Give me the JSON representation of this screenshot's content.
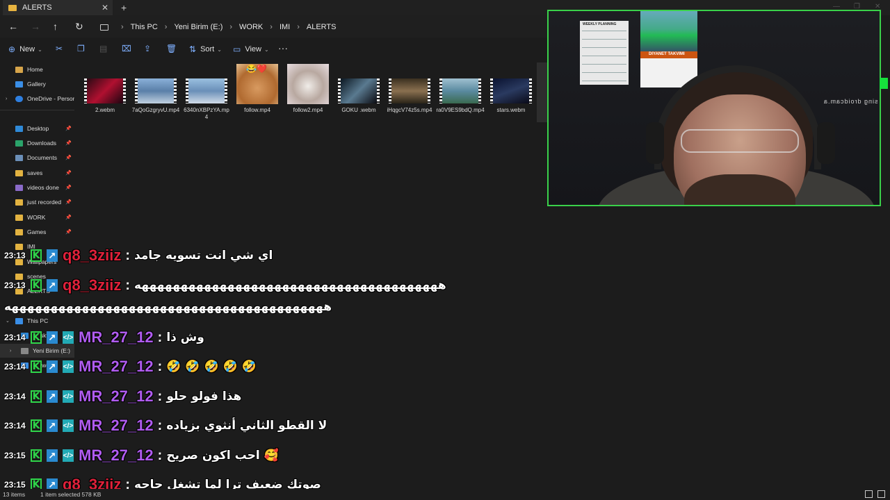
{
  "titlebar": {
    "tab_title": "ALERTS",
    "close_glyph": "✕",
    "new_tab_glyph": "+"
  },
  "address": {
    "crumbs": [
      "This PC",
      "Yeni Birim (E:)",
      "WORK",
      "IMI",
      "ALERTS"
    ],
    "separator": "›"
  },
  "toolbar": {
    "new_label": "New",
    "sort_label": "Sort",
    "view_label": "View",
    "more_glyph": "···"
  },
  "sidebar": {
    "items": [
      {
        "label": "Home"
      },
      {
        "label": "Gallery"
      },
      {
        "label": "OneDrive - Persona"
      },
      {
        "label": "Desktop"
      },
      {
        "label": "Downloads"
      },
      {
        "label": "Documents"
      },
      {
        "label": "saves"
      },
      {
        "label": "videos done"
      },
      {
        "label": "just recorded"
      },
      {
        "label": "WORK"
      },
      {
        "label": "Games"
      },
      {
        "label": "IMI"
      },
      {
        "label": "Wallpapers"
      },
      {
        "label": "scenes"
      },
      {
        "label": "ALERTS"
      },
      {
        "label": "This PC"
      },
      {
        "label": "Desktop"
      },
      {
        "label": "Yeni Birim (E:)"
      },
      {
        "label": "Network"
      }
    ]
  },
  "files": [
    {
      "name": "2.webm",
      "color": "#b01030"
    },
    {
      "name": "7aQoGzgryvU.mp4",
      "color": "#7aa0c8"
    },
    {
      "name": "6340nXBPzYA.mp4",
      "color": "#8aaed0"
    },
    {
      "name": "follow.mp4",
      "color": "#d89a60"
    },
    {
      "name": "follow2.mp4",
      "color": "#d8c8c0"
    },
    {
      "name": "GOKU .webm",
      "color": "#5a7a90"
    },
    {
      "name": "iHqgcV74z5s.mp4",
      "color": "#6a5a3a"
    },
    {
      "name": "ra0V9ES9bdQ.mp4",
      "color": "#5a8aa0"
    },
    {
      "name": "stars.webm",
      "color": "#2a3a60"
    }
  ],
  "webcam": {
    "planner_title": "WEEKLY PLANNING",
    "calendar_title": "DIYANET TAKVIMI",
    "mirrored_text": "sing droidcam.a"
  },
  "chat": [
    {
      "time": "23:13",
      "user": "q8_3ziiz",
      "color": "#e0213a",
      "text": "اي شي انت تسويه جامد"
    },
    {
      "time": "23:13",
      "user": "q8_3ziiz",
      "color": "#e0213a",
      "text": "هههههههههههههههههههههههههههههههههههههههه"
    },
    {
      "time": "23:14",
      "user": "MR_27_12",
      "color": "#b05cf0",
      "text": "وش ذا"
    },
    {
      "time": "23:14",
      "user": "MR_27_12",
      "color": "#b05cf0",
      "text": "🤣 🤣 🤣 🤣 🤣"
    },
    {
      "time": "23:14",
      "user": "MR_27_12",
      "color": "#b05cf0",
      "text": "هذا فولو حلو"
    },
    {
      "time": "23:14",
      "user": "MR_27_12",
      "color": "#b05cf0",
      "text": "لا القطو الثاني أنثوي بزياده"
    },
    {
      "time": "23:15",
      "user": "MR_27_12",
      "color": "#b05cf0",
      "text": "احب اكون صريح 🥰"
    },
    {
      "time": "23:15",
      "user": "q8_3ziiz",
      "color": "#e0213a",
      "text": "صوتك ضعيف ترا لما تشغل حاجه"
    }
  ],
  "chat_wrap": "هههههههههههههههههههههههههههههههههههههههههه",
  "badges": {
    "k": "K",
    "arrow": "↗",
    "dev": "</>"
  },
  "status": {
    "items": "13 items",
    "selected": "1 item selected  578 KB"
  }
}
